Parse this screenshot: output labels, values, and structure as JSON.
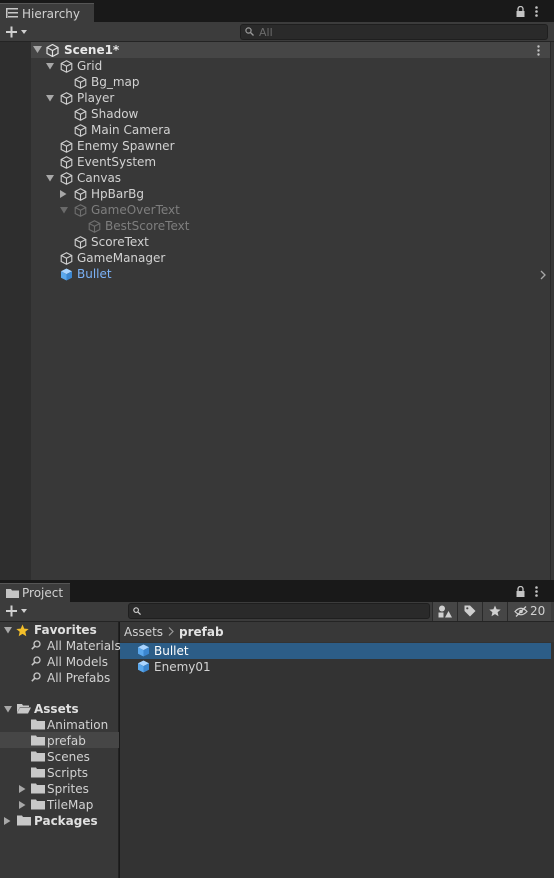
{
  "hierarchy": {
    "tab_label": "Hierarchy",
    "search": {
      "placeholder": "All"
    },
    "scene": {
      "label": "Scene1*"
    },
    "items": [
      {
        "label": "Grid"
      },
      {
        "label": "Bg_map"
      },
      {
        "label": "Player"
      },
      {
        "label": "Shadow"
      },
      {
        "label": "Main Camera"
      },
      {
        "label": "Enemy Spawner"
      },
      {
        "label": "EventSystem"
      },
      {
        "label": "Canvas"
      },
      {
        "label": "HpBarBg"
      },
      {
        "label": "GameOverText"
      },
      {
        "label": "BestScoreText"
      },
      {
        "label": "ScoreText"
      },
      {
        "label": "GameManager"
      },
      {
        "label": "Bullet"
      }
    ]
  },
  "project": {
    "tab_label": "Project",
    "hidden_count": "20",
    "favorites": {
      "label": "Favorites",
      "items": [
        {
          "label": "All Materials"
        },
        {
          "label": "All Models"
        },
        {
          "label": "All Prefabs"
        }
      ]
    },
    "assets": {
      "label": "Assets",
      "folders": [
        {
          "label": "Animation"
        },
        {
          "label": "prefab"
        },
        {
          "label": "Scenes"
        },
        {
          "label": "Scripts"
        },
        {
          "label": "Sprites"
        },
        {
          "label": "TileMap"
        }
      ]
    },
    "packages": {
      "label": "Packages"
    },
    "breadcrumb": {
      "root": "Assets",
      "current": "prefab"
    },
    "files": [
      {
        "label": "Bullet"
      },
      {
        "label": "Enemy01"
      }
    ]
  },
  "colors": {
    "selection": "#2c5d87",
    "prefab_text": "#7bb2f7",
    "inactive_text": "#7e7e7e",
    "panel_bg": "#383838"
  }
}
